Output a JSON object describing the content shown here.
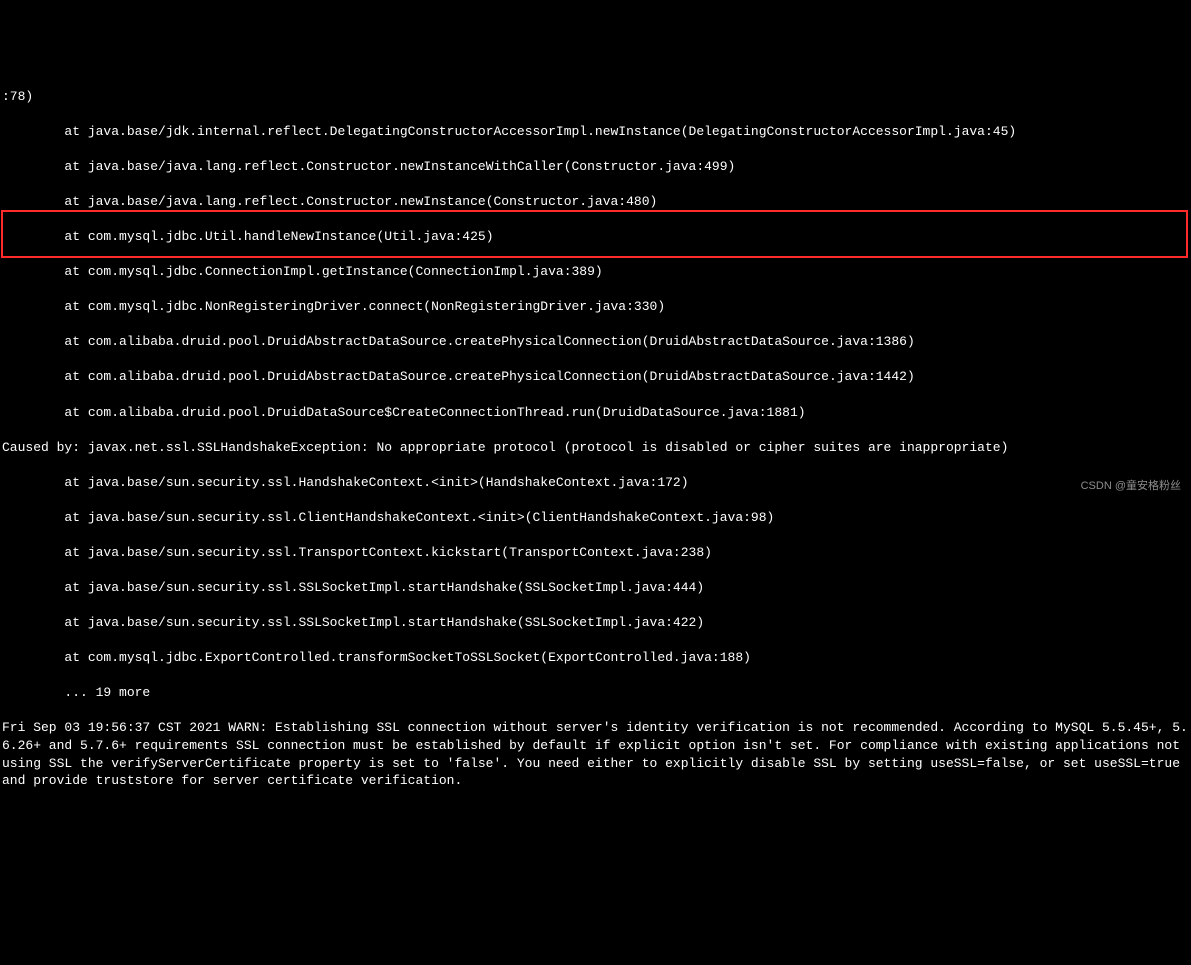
{
  "stack": {
    "head": ":78)",
    "frames_top": [
      "        at java.base/jdk.internal.reflect.DelegatingConstructorAccessorImpl.newInstance(DelegatingConstructorAccessorImpl.java:45)",
      "        at java.base/java.lang.reflect.Constructor.newInstanceWithCaller(Constructor.java:499)",
      "        at java.base/java.lang.reflect.Constructor.newInstance(Constructor.java:480)",
      "        at com.mysql.jdbc.Util.handleNewInstance(Util.java:425)",
      "        at com.mysql.jdbc.ConnectionImpl.getInstance(ConnectionImpl.java:389)",
      "        at com.mysql.jdbc.NonRegisteringDriver.connect(NonRegisteringDriver.java:330)",
      "        at com.alibaba.druid.pool.DruidAbstractDataSource.createPhysicalConnection(DruidAbstractDataSource.java:1386)",
      "        at com.alibaba.druid.pool.DruidAbstractDataSource.createPhysicalConnection(DruidAbstractDataSource.java:1442)",
      "        at com.alibaba.druid.pool.DruidDataSource$CreateConnectionThread.run(DruidDataSource.java:1881)"
    ],
    "caused_by": "Caused by: javax.net.ssl.SSLHandshakeException: No appropriate protocol (protocol is disabled or cipher suites are inappropriate)",
    "frames_bottom": [
      "        at java.base/sun.security.ssl.HandshakeContext.<init>(HandshakeContext.java:172)",
      "        at java.base/sun.security.ssl.ClientHandshakeContext.<init>(ClientHandshakeContext.java:98)",
      "        at java.base/sun.security.ssl.TransportContext.kickstart(TransportContext.java:238)",
      "        at java.base/sun.security.ssl.SSLSocketImpl.startHandshake(SSLSocketImpl.java:444)",
      "        at java.base/sun.security.ssl.SSLSocketImpl.startHandshake(SSLSocketImpl.java:422)",
      "        at com.mysql.jdbc.ExportControlled.transformSocketToSSLSocket(ExportControlled.java:188)",
      "        ... 19 more"
    ],
    "warn": "Fri Sep 03 19:56:37 CST 2021 WARN: Establishing SSL connection without server's identity verification is not recommended. According to MySQL 5.5.45+, 5.6.26+ and 5.7.6+ requirements SSL connection must be established by default if explicit option isn't set. For compliance with existing applications not using SSL the verifyServerCertificate property is set to 'false'. You need either to explicitly disable SSL by setting useSSL=false, or set useSSL=true and provide truststore for server certificate verification."
  },
  "watermark": "CSDN @童安格粉丝"
}
